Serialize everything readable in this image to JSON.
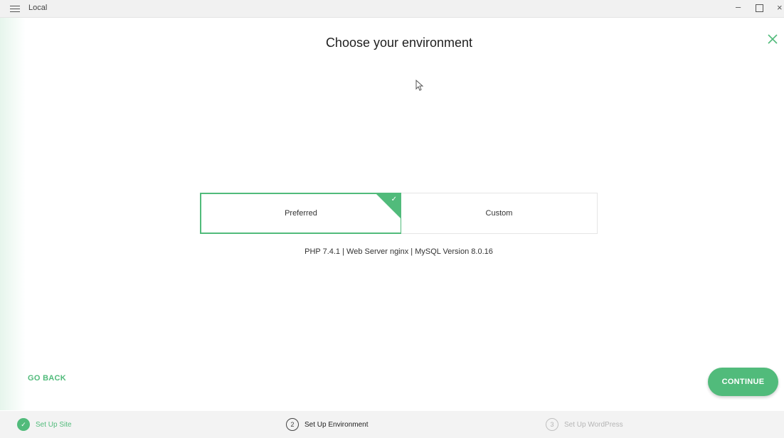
{
  "window": {
    "app_title": "Local"
  },
  "page": {
    "title": "Choose your environment"
  },
  "options": {
    "preferred_label": "Preferred",
    "custom_label": "Custom",
    "selected": "Preferred"
  },
  "env_info": "PHP 7.4.1 | Web Server nginx | MySQL Version 8.0.16",
  "actions": {
    "go_back": "GO BACK",
    "continue": "CONTINUE"
  },
  "steps": [
    {
      "number": "✓",
      "label": "Set Up Site",
      "state": "completed"
    },
    {
      "number": "2",
      "label": "Set Up Environment",
      "state": "current"
    },
    {
      "number": "3",
      "label": "Set Up WordPress",
      "state": "upcoming"
    }
  ],
  "colors": {
    "accent": "#51bb7b"
  }
}
